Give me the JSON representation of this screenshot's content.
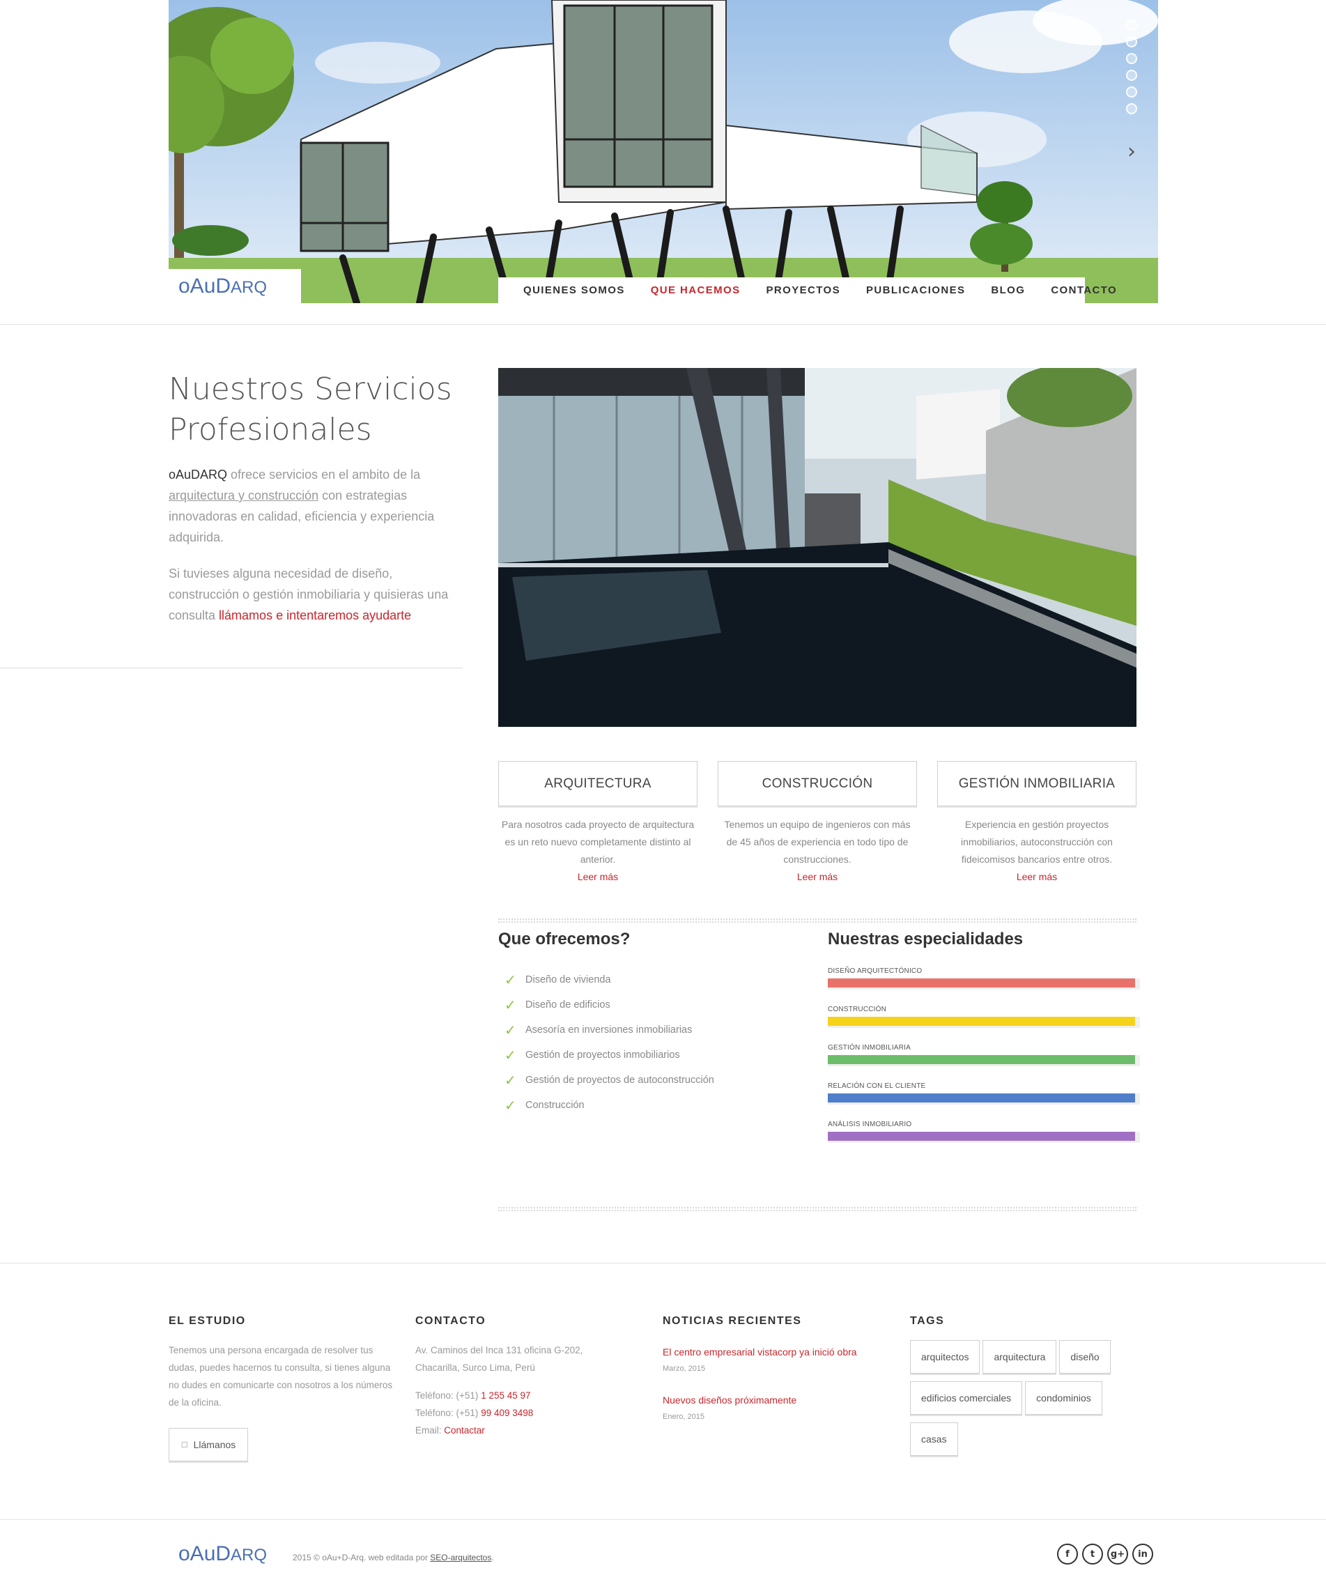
{
  "brand": {
    "logo_big": "oAuD",
    "logo_small": "ARQ"
  },
  "nav": {
    "items": [
      {
        "label": "QUIENES SOMOS",
        "active": false
      },
      {
        "label": "QUE HACEMOS",
        "active": true
      },
      {
        "label": "PROYECTOS",
        "active": false
      },
      {
        "label": "PUBLICACIONES",
        "active": false
      },
      {
        "label": "BLOG",
        "active": false
      },
      {
        "label": "CONTACTO",
        "active": false
      }
    ]
  },
  "slider": {
    "dots": 6,
    "active_dot": 1,
    "next_icon": "chevron-right-icon"
  },
  "intro": {
    "title": "Nuestros Servicios Profesionales",
    "p1_brand": "oAuDARQ",
    "p1_text_a": " ofrece servicios en el ambito de la ",
    "p1_link": "arquitectura y construcción",
    "p1_text_b": " con estrategias innovadoras en calidad, eficiencia y experiencia adquirida.",
    "p2_text": "Si tuvieses alguna necesidad de diseño, construcción o gestión inmobiliaria y quisieras una consulta ",
    "p2_link": "llámamos e intentaremos ayudarte"
  },
  "services": [
    {
      "title": "ARQUITECTURA",
      "desc": "Para nosotros cada proyecto de arquitectura es un reto nuevo completamente distinto al anterior.",
      "link": "Leer más"
    },
    {
      "title": "CONSTRUCCIÓN",
      "desc": "Tenemos un equipo de ingenieros con más de 45 años de experiencia en todo tipo de construcciones.",
      "link": "Leer más"
    },
    {
      "title": "GESTIÓN INMOBILIARIA",
      "desc": "Experiencia en gestión proyectos inmobiliarios, autoconstrucción con fideicomisos bancarios entre otros.",
      "link": "Leer más"
    }
  ],
  "offer": {
    "heading": "Que ofrecemos?",
    "items": [
      "Diseño de vivienda",
      "Diseño de edificios",
      "Asesoría en inversiones inmobiliarias",
      "Gestión de proyectos inmobiliarios",
      "Gestión de proyectos de autoconstrucción",
      "Construcción"
    ]
  },
  "skills": {
    "heading": "Nuestras especialidades",
    "items": [
      {
        "label": "DISEÑO ARQUITECTÓNICO",
        "level": 0.985,
        "color": "#e8726a"
      },
      {
        "label": "CONSTRUCCIÓN",
        "level": 0.985,
        "color": "#f6d31b"
      },
      {
        "label": "GESTIÓN INMOBILIARIA",
        "level": 0.985,
        "color": "#6cbd6a"
      },
      {
        "label": "RELACIÓN CON EL CLIENTE",
        "level": 0.985,
        "color": "#4f7fca"
      },
      {
        "label": "ANÁLISIS INMOBILIARIO",
        "level": 0.985,
        "color": "#a070c4"
      }
    ]
  },
  "footer": {
    "estudio": {
      "heading": "EL ESTUDIO",
      "text": "Tenemos una persona encargada de resolver tus dudas, puedes hacernos tu consulta, si tienes alguna no dudes en comunicarte con nosotros a los números de la oficina.",
      "button": "Llámanos"
    },
    "contacto": {
      "heading": "CONTACTO",
      "address": "Av. Caminos del Inca 131 oficina G-202, Chacarilla, Surco Lima, Perú",
      "phone_label": "Teléfono: (+51) ",
      "phone1": "1 255 45 97",
      "phone2": "99 409 3498",
      "email_label": "Email: ",
      "email_link": "Contactar"
    },
    "noticias": {
      "heading": "NOTICIAS RECIENTES",
      "items": [
        {
          "title": "El centro empresarial vistacorp ya inició obra",
          "date": "Marzo, 2015"
        },
        {
          "title": "Nuevos diseños próximamente",
          "date": "Enero, 2015"
        }
      ]
    },
    "tags": {
      "heading": "TAGS",
      "items": [
        "arquitectos",
        "arquitectura",
        "diseño",
        "edificios comerciales",
        "condominios",
        "casas"
      ]
    }
  },
  "bottom": {
    "copyright_a": "2015 © oAu+D-Arq. web editada por ",
    "copyright_link": "SEO-arquitectos",
    "copyright_b": ".",
    "socials": [
      {
        "icon": "facebook-icon",
        "glyph": "f"
      },
      {
        "icon": "twitter-icon",
        "glyph": "t"
      },
      {
        "icon": "google-plus-icon",
        "glyph": "g+"
      },
      {
        "icon": "linkedin-icon",
        "glyph": "in"
      }
    ]
  }
}
